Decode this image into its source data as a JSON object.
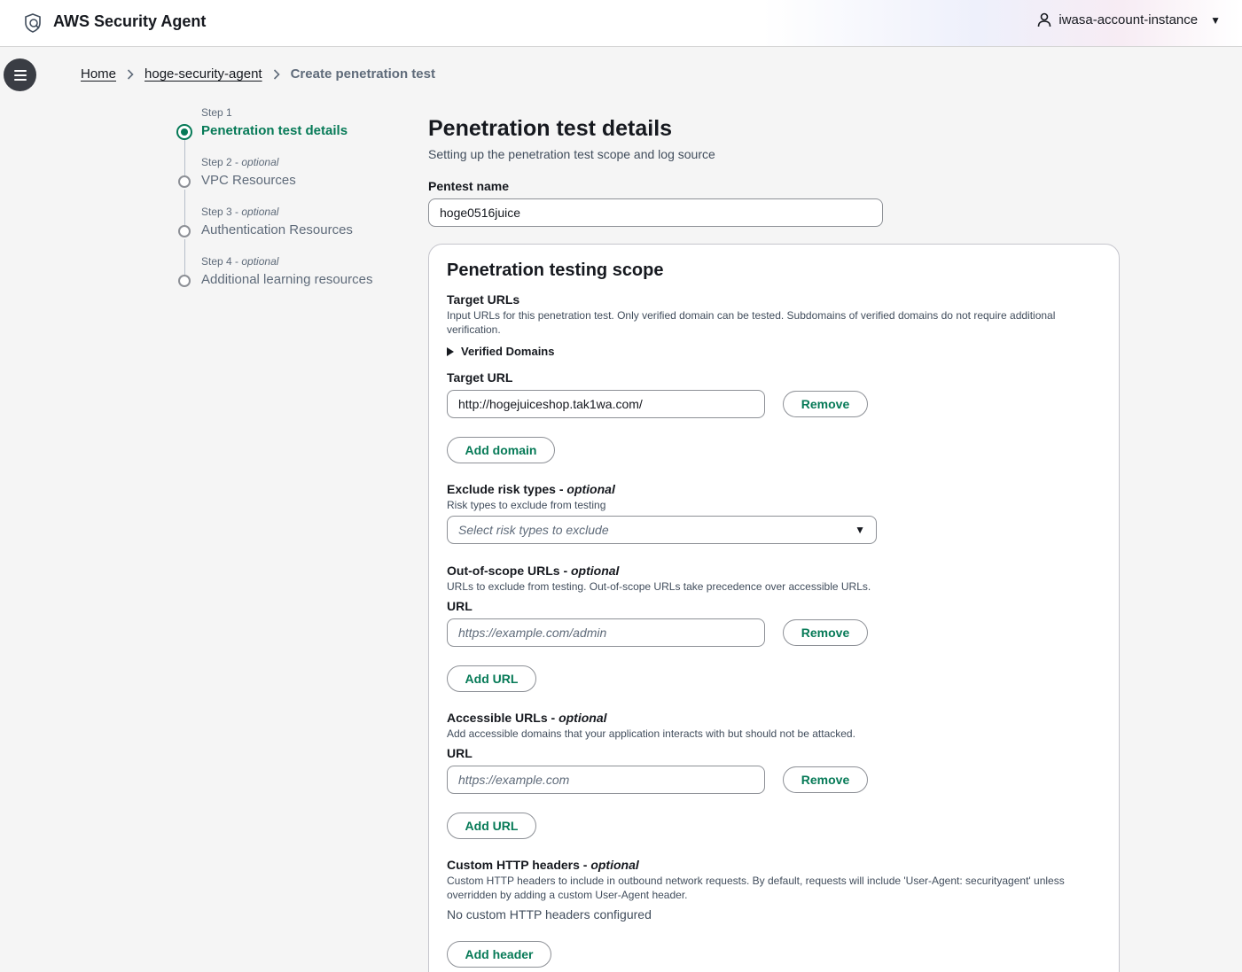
{
  "header": {
    "app_title": "AWS Security Agent",
    "account": "iwasa-account-instance",
    "icons": [
      "shield-logo-icon",
      "user-icon",
      "caret-down-icon",
      "menu-icon"
    ]
  },
  "breadcrumb": {
    "home": "Home",
    "agent": "hoge-security-agent",
    "current": "Create penetration test"
  },
  "steps": [
    {
      "small": "Step 1",
      "optional": "",
      "label": "Penetration test details",
      "active": true
    },
    {
      "small": "Step 2",
      "optional": "optional",
      "label": "VPC Resources",
      "active": false
    },
    {
      "small": "Step 3",
      "optional": "optional",
      "label": "Authentication Resources",
      "active": false
    },
    {
      "small": "Step 4",
      "optional": "optional",
      "label": "Additional learning resources",
      "active": false
    }
  ],
  "main": {
    "title": "Penetration test details",
    "subtitle": "Setting up the penetration test scope and log source",
    "pentest_name_label": "Pentest name",
    "pentest_name_value": "hoge0516juice"
  },
  "scope": {
    "title": "Penetration testing scope",
    "target_urls_title": "Target URLs",
    "target_urls_desc": "Input URLs for this penetration test. Only verified domain can be tested. Subdomains of verified domains do not require additional verification.",
    "verified_domains": "Verified Domains",
    "target_url_label": "Target URL",
    "target_url_value": "http://hogejuiceshop.tak1wa.com/",
    "remove_label": "Remove",
    "add_domain_label": "Add domain",
    "exclude_title": "Exclude risk types - ",
    "optional": "optional",
    "exclude_desc": "Risk types to exclude from testing",
    "exclude_placeholder": "Select risk types to exclude",
    "oos_title": "Out-of-scope URLs - ",
    "oos_desc": "URLs to exclude from testing. Out-of-scope URLs take precedence over accessible URLs.",
    "url_label": "URL",
    "oos_placeholder": "https://example.com/admin",
    "add_url_label": "Add URL",
    "acc_title": "Accessible URLs - ",
    "acc_desc": "Add accessible domains that your application interacts with but should not be attacked.",
    "acc_placeholder": "https://example.com",
    "headers_title": "Custom HTTP headers - ",
    "headers_desc": "Custom HTTP headers to include in outbound network requests. By default, requests will include 'User-Agent: securityagent' unless overridden by adding a custom User-Agent header.",
    "headers_empty": "No custom HTTP headers configured",
    "add_header_label": "Add header"
  },
  "colors": {
    "accent": "#067a57",
    "text": "#16191f",
    "muted": "#5f6b7a"
  }
}
